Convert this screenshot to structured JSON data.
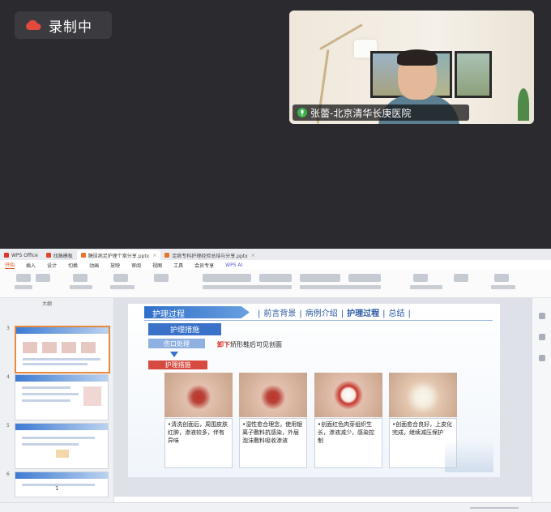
{
  "recording": {
    "label": "录制中"
  },
  "camera": {
    "participant_name": "张蕾-北京清华长庚医院"
  },
  "slide": {
    "section_title": "护理过程",
    "nav_tabs": [
      "前言背景",
      "病例介绍",
      "护理过程",
      "总结"
    ],
    "heading_blue": "护理措施",
    "subheading": "伤口处理",
    "note_highlight": "卸下",
    "note_rest": "矫形鞋后可见创面",
    "red_label": "护理措施",
    "cards": [
      {
        "text": "•清洗创面后，周围皮肤红肿，渗液较多，伴有异味"
      },
      {
        "text": "•湿性愈合理念，使用银离子敷料抗感染，外层泡沫敷料吸收渗液"
      },
      {
        "text": "•创面红色肉芽组织生长，渗液减少，感染控制"
      },
      {
        "text": "•创面愈合良好，上皮化完成，继续减压保护"
      }
    ]
  },
  "app": {
    "tabs": [
      "WPS Office",
      "找稿模板",
      "糖尿病足护理个案分享.pptx",
      "足病专科护理经验总结与分享.pptx"
    ],
    "menus": [
      "开始",
      "插入",
      "设计",
      "切换",
      "动画",
      "放映",
      "审阅",
      "视图",
      "工具",
      "会员专享",
      "WPS AI"
    ],
    "side_tab": "大纲",
    "page_number": "1"
  }
}
